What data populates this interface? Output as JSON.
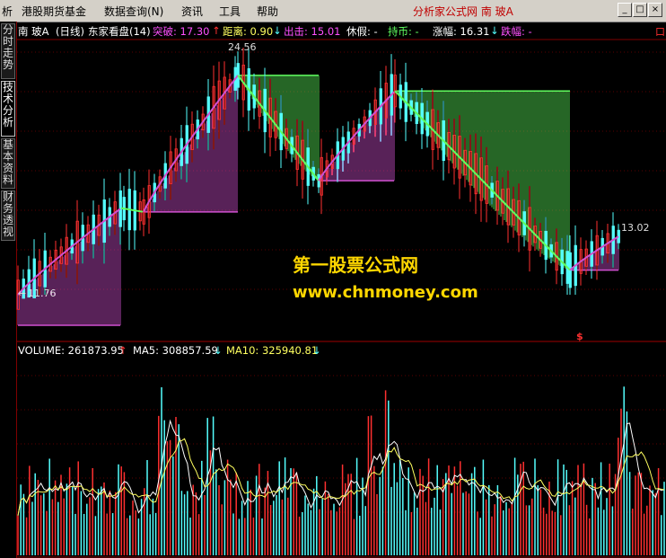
{
  "menu": {
    "left_cut": "析",
    "items": [
      "港股期货基金",
      "数据查询(N)",
      "资讯",
      "工具",
      "帮助"
    ],
    "right_title": "分析家公式网  南   玻A",
    "win_min": "_",
    "win_max": "□",
    "win_close": "×"
  },
  "sidebar": {
    "tabs": [
      "分时走势",
      "技术分析",
      "基本资料",
      "财务透视"
    ],
    "active": 1,
    "right_cut": "口"
  },
  "indicator_legend": {
    "stock": "南  玻A",
    "period": "(日线)",
    "formula": "东家看盘(14)",
    "break_label": "突破: 17.30",
    "break_arrow": "↑",
    "distance_label": "距离: 0.90",
    "distance_arrow": "↓",
    "exit_label": "出击: 15.01",
    "rest_label": "休假: -",
    "hold_label": "持币: -",
    "rise_label": "涨幅: 16.31",
    "rise_arrow": "↓",
    "fall_label": "跌幅: -"
  },
  "price_annotations": {
    "high": "24.56",
    "low": "11.76",
    "low_arrow": "←",
    "recent": "13.02",
    "marker": "$"
  },
  "volume_legend": {
    "volume": "VOLUME: 261873.95",
    "volume_arrow": "↑",
    "ma5": "MA5: 308857.59",
    "ma5_arrow": "↓",
    "ma10": "MA10: 325940.81",
    "ma10_arrow": "↓"
  },
  "watermark": {
    "line1": "第一股票公式网",
    "line2": "www.chnmoney.com"
  },
  "colors": {
    "up": "#ff3030",
    "down": "#54ffff",
    "magenta_band": "#d050d0",
    "green_band": "#60ff60",
    "ma5": "#ffffff",
    "ma10": "#ffff60"
  },
  "chart_data": {
    "type": "candlestick-with-volume",
    "price_range": [
      11.76,
      24.56
    ],
    "phases": [
      {
        "kind": "up",
        "color": "magenta",
        "start": 11.76,
        "end": 16.2
      },
      {
        "kind": "flat",
        "start": 16.2,
        "end": 16.0
      },
      {
        "kind": "up",
        "color": "magenta",
        "start": 16.0,
        "end": 23.0
      },
      {
        "kind": "down",
        "color": "green",
        "start": 23.0,
        "end": 17.6
      },
      {
        "kind": "up",
        "color": "magenta",
        "start": 17.6,
        "end": 22.2
      },
      {
        "kind": "down",
        "color": "green",
        "start": 22.2,
        "end": 13.02
      },
      {
        "kind": "up",
        "color": "magenta",
        "start": 13.02,
        "end": 14.8
      }
    ],
    "volume_series": [
      "VOLUME",
      "MA5",
      "MA10"
    ]
  }
}
